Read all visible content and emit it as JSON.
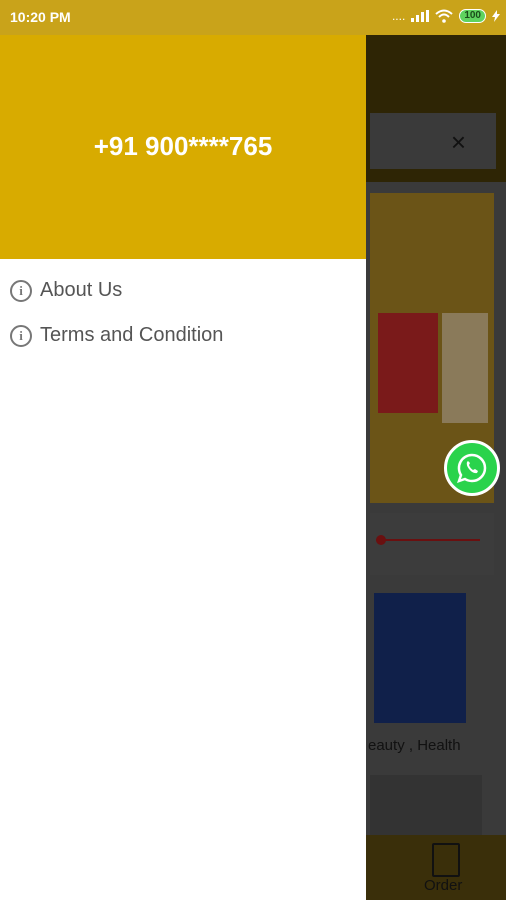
{
  "status_bar": {
    "time": "10:20 PM",
    "signal_text": "....",
    "battery_level": "100"
  },
  "drawer": {
    "phone": "+91 900****765",
    "menu": [
      {
        "label": "About Us",
        "icon": "info-icon"
      },
      {
        "label": "Terms and Condition",
        "icon": "info-icon"
      }
    ]
  },
  "background": {
    "close_glyph": "×",
    "product_text": "eauty , Health",
    "bottom_nav": {
      "order_label": "Order"
    }
  },
  "colors": {
    "drawer_header": "#d8ab00",
    "status_bar": "#c9a31a",
    "whatsapp": "#2ad34c"
  }
}
